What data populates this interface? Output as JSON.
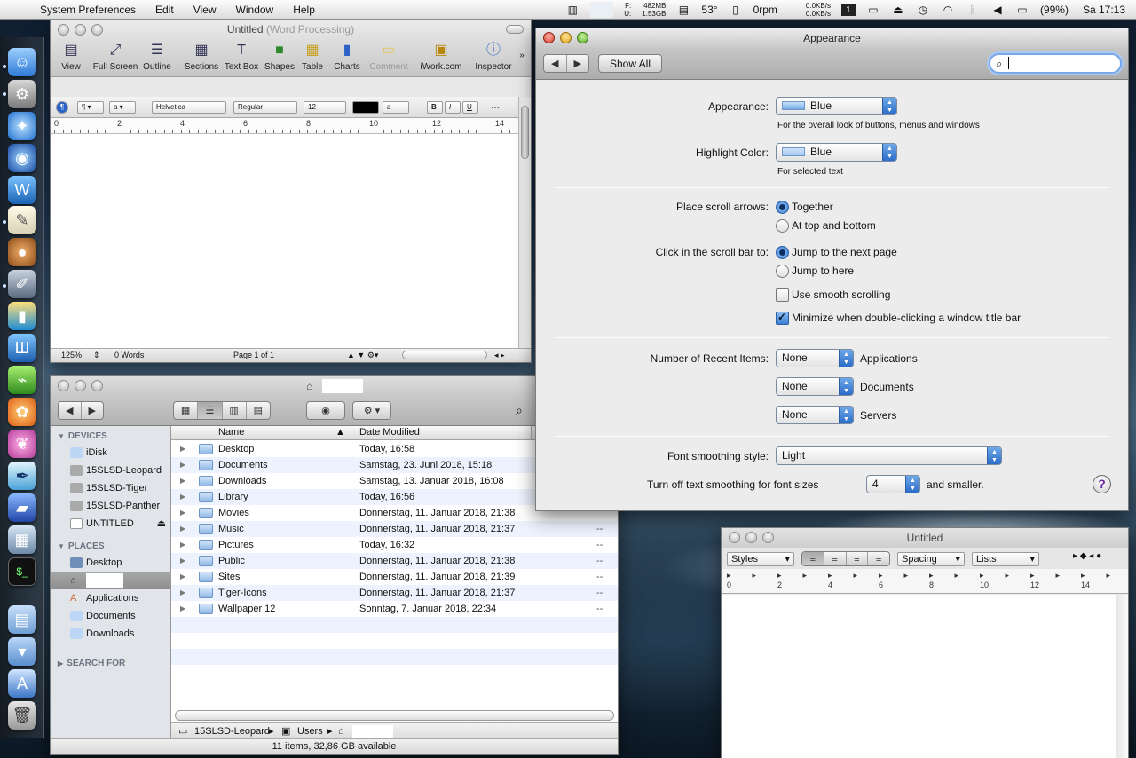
{
  "menubar": {
    "apple": "",
    "app_name": "System Preferences",
    "items": [
      "Edit",
      "View",
      "Window",
      "Help"
    ],
    "mem_free": "482MB",
    "mem_used": "1.53GB",
    "mem_labels": [
      "F:",
      "U:"
    ],
    "temperature": "53°",
    "fan": "0rpm",
    "net_in": "0.0KB/s",
    "net_out": "0.0KB/s",
    "battery": "(99%)",
    "clock": "Sa 17:13"
  },
  "pages": {
    "title": "Untitled",
    "subtitle": "(Word Processing)",
    "toolbar": [
      "View",
      "Full Screen",
      "Outline",
      "Sections",
      "Text Box",
      "Shapes",
      "Table",
      "Charts",
      "Comment",
      "iWork.com",
      "Inspector"
    ],
    "font": "Helvetica",
    "style": "Regular",
    "size": "12",
    "ruler_marks": [
      "0",
      "2",
      "4",
      "6",
      "8",
      "10",
      "12",
      "14"
    ],
    "zoom": "125%",
    "words": "0 Words",
    "page": "Page 1 of 1"
  },
  "finder": {
    "devices_label": "DEVICES",
    "devices": [
      "iDisk",
      "15SLSD-Leopard",
      "15SLSD-Tiger",
      "15SLSD-Panther",
      "UNTITLED"
    ],
    "places_label": "PLACES",
    "places": [
      "Desktop",
      "Applications",
      "Documents",
      "Downloads"
    ],
    "search_label": "SEARCH FOR",
    "col_name": "Name",
    "col_date": "Date Modified",
    "rows": [
      {
        "name": "Desktop",
        "date": "Today, 16:58",
        "size": ""
      },
      {
        "name": "Documents",
        "date": "Samstag, 23. Juni 2018, 15:18",
        "size": ""
      },
      {
        "name": "Downloads",
        "date": "Samstag, 13. Januar 2018, 16:08",
        "size": ""
      },
      {
        "name": "Library",
        "date": "Today, 16:56",
        "size": ""
      },
      {
        "name": "Movies",
        "date": "Donnerstag, 11. Januar 2018, 21:38",
        "size": ""
      },
      {
        "name": "Music",
        "date": "Donnerstag, 11. Januar 2018, 21:37",
        "size": "--"
      },
      {
        "name": "Pictures",
        "date": "Today, 16:32",
        "size": "--"
      },
      {
        "name": "Public",
        "date": "Donnerstag, 11. Januar 2018, 21:38",
        "size": "--"
      },
      {
        "name": "Sites",
        "date": "Donnerstag, 11. Januar 2018, 21:39",
        "size": "--"
      },
      {
        "name": "Tiger-Icons",
        "date": "Donnerstag, 11. Januar 2018, 21:37",
        "size": "--"
      },
      {
        "name": "Wallpaper 12",
        "date": "Sonntag, 7. Januar 2018, 22:34",
        "size": "--"
      }
    ],
    "path": [
      "15SLSD-Leopard",
      "Users"
    ],
    "status": "11 items, 32,86 GB available"
  },
  "prefs": {
    "title": "Appearance",
    "show_all": "Show All",
    "appearance_label": "Appearance:",
    "appearance_value": "Blue",
    "appearance_hint": "For the overall look of buttons, menus and windows",
    "highlight_label": "Highlight Color:",
    "highlight_value": "Blue",
    "highlight_hint": "For selected text",
    "scroll_arrows_label": "Place scroll arrows:",
    "scroll_arrows_options": [
      "Together",
      "At top and bottom"
    ],
    "scroll_click_label": "Click in the scroll bar to:",
    "scroll_click_options": [
      "Jump to the next page",
      "Jump to here"
    ],
    "smooth_scrolling": "Use smooth scrolling",
    "minimize_dblclick": "Minimize when double-clicking a window title bar",
    "recent_label": "Number of Recent Items:",
    "recent": [
      {
        "value": "None",
        "label": "Applications"
      },
      {
        "value": "None",
        "label": "Documents"
      },
      {
        "value": "None",
        "label": "Servers"
      }
    ],
    "font_smoothing_label": "Font smoothing style:",
    "font_smoothing_value": "Light",
    "turn_off_label": "Turn off text smoothing for font sizes",
    "turn_off_value": "4",
    "turn_off_suffix": "and smaller.",
    "help": "?"
  },
  "textedit": {
    "title": "Untitled",
    "styles": "Styles",
    "spacing": "Spacing",
    "lists": "Lists",
    "ruler_marks": [
      "0",
      "2",
      "4",
      "6",
      "8",
      "10",
      "12",
      "14"
    ]
  }
}
